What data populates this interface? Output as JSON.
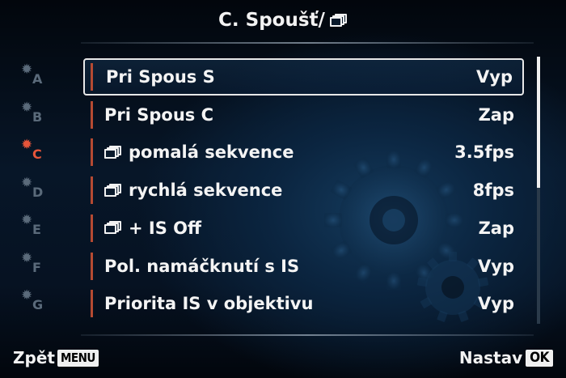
{
  "header": {
    "title": "C. Spoušť/",
    "title_icon": "burst-drive-icon"
  },
  "side_tabs": [
    {
      "letter": "A",
      "icon": "gear-icon",
      "active": false
    },
    {
      "letter": "B",
      "icon": "gear-icon",
      "active": false
    },
    {
      "letter": "C",
      "icon": "gear-icon",
      "active": true
    },
    {
      "letter": "D",
      "icon": "gear-icon",
      "active": false
    },
    {
      "letter": "E",
      "icon": "gear-icon",
      "active": false
    },
    {
      "letter": "F",
      "icon": "gear-icon",
      "active": false
    },
    {
      "letter": "G",
      "icon": "gear-icon",
      "active": false
    }
  ],
  "menu": {
    "items": [
      {
        "label": "Pri Spous S",
        "value": "Vyp",
        "has_burst_icon": false,
        "selected": true
      },
      {
        "label": "Pri Spous C",
        "value": "Zap",
        "has_burst_icon": false,
        "selected": false
      },
      {
        "label": "pomalá sekvence",
        "value": "3.5fps",
        "has_burst_icon": true,
        "selected": false
      },
      {
        "label": "rychlá sekvence",
        "value": "8fps",
        "has_burst_icon": true,
        "selected": false
      },
      {
        "label": "+ IS Off",
        "value": "Zap",
        "has_burst_icon": true,
        "selected": false
      },
      {
        "label": "Pol. namáčknutí s IS",
        "value": "Vyp",
        "has_burst_icon": false,
        "selected": false
      },
      {
        "label": "Priorita IS v objektivu",
        "value": "Vyp",
        "has_burst_icon": false,
        "selected": false
      }
    ]
  },
  "scroll": {
    "visible_fraction": 0.49,
    "position_fraction": 0.0
  },
  "footer": {
    "back_label": "Zpět",
    "back_key": "MENU",
    "set_label": "Nastav",
    "set_key": "OK"
  },
  "colors": {
    "accent_active": "#e6553a",
    "inactive_tab": "#5a6a7a",
    "item_bar": "#b54a32",
    "text": "#f4f4f4"
  }
}
